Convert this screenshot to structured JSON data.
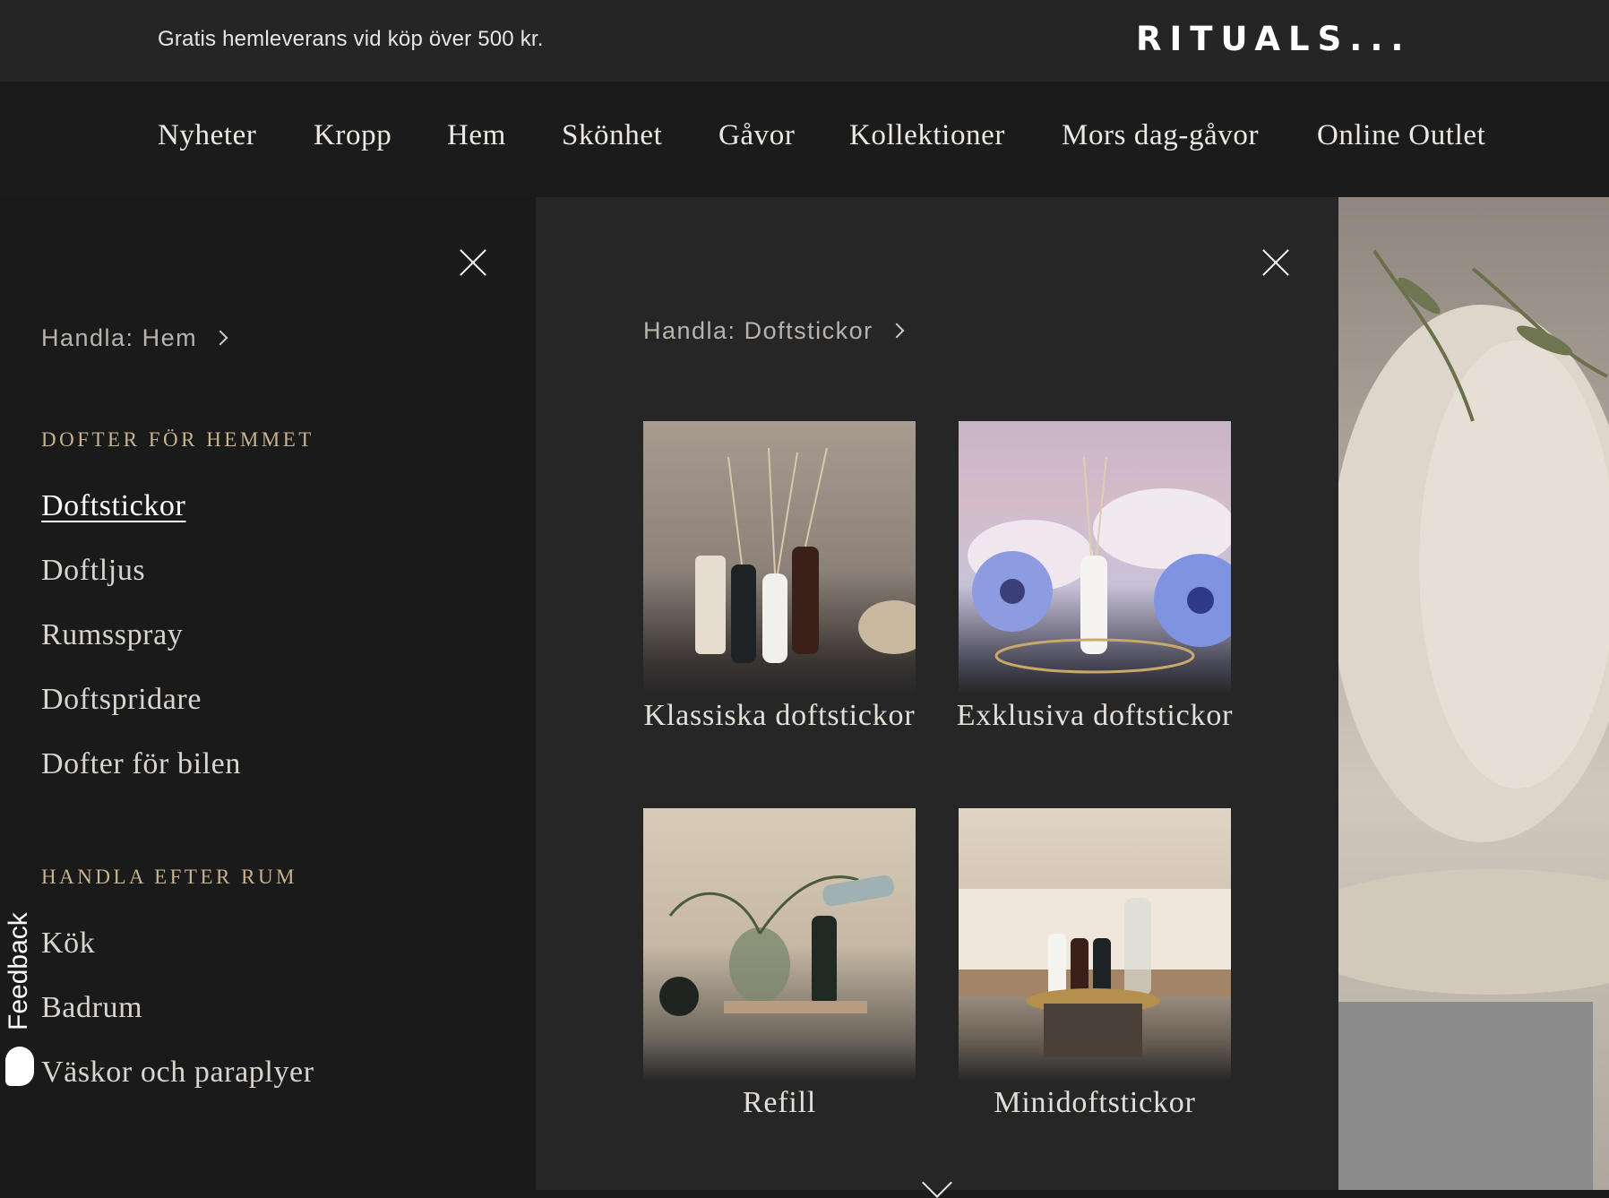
{
  "promo_bar": {
    "text": "Gratis hemleverans vid köp över 500 kr.",
    "logo": "RITUALS..."
  },
  "main_nav": {
    "items": [
      {
        "label": "Nyheter"
      },
      {
        "label": "Kropp"
      },
      {
        "label": "Hem"
      },
      {
        "label": "Skönhet"
      },
      {
        "label": "Gåvor"
      },
      {
        "label": "Kollektioner"
      },
      {
        "label": "Mors dag-gåvor"
      },
      {
        "label": "Online Outlet"
      }
    ]
  },
  "left_panel": {
    "breadcrumb": "Handla: Hem",
    "section1": {
      "heading": "DOFTER FÖR HEMMET",
      "items": [
        {
          "label": "Doftstickor",
          "active": true
        },
        {
          "label": "Doftljus"
        },
        {
          "label": "Rumsspray"
        },
        {
          "label": "Doftspridare"
        },
        {
          "label": "Dofter för bilen"
        }
      ]
    },
    "section2": {
      "heading": "HANDLA EFTER RUM",
      "items": [
        {
          "label": "Kök"
        },
        {
          "label": "Badrum"
        },
        {
          "label": "Väskor och paraplyer"
        }
      ]
    }
  },
  "mid_panel": {
    "breadcrumb": "Handla: Doftstickor",
    "cards": [
      {
        "label": "Klassiska doftstickor"
      },
      {
        "label": "Exklusiva doftstickor"
      },
      {
        "label": "Refill"
      },
      {
        "label": "Minidoftstickor"
      }
    ]
  },
  "feedback": {
    "label": "Feedback"
  },
  "colors": {
    "accent_gold": "#c8b48f",
    "panel_dark": "#1a1a1b",
    "panel_mid": "#262627"
  }
}
